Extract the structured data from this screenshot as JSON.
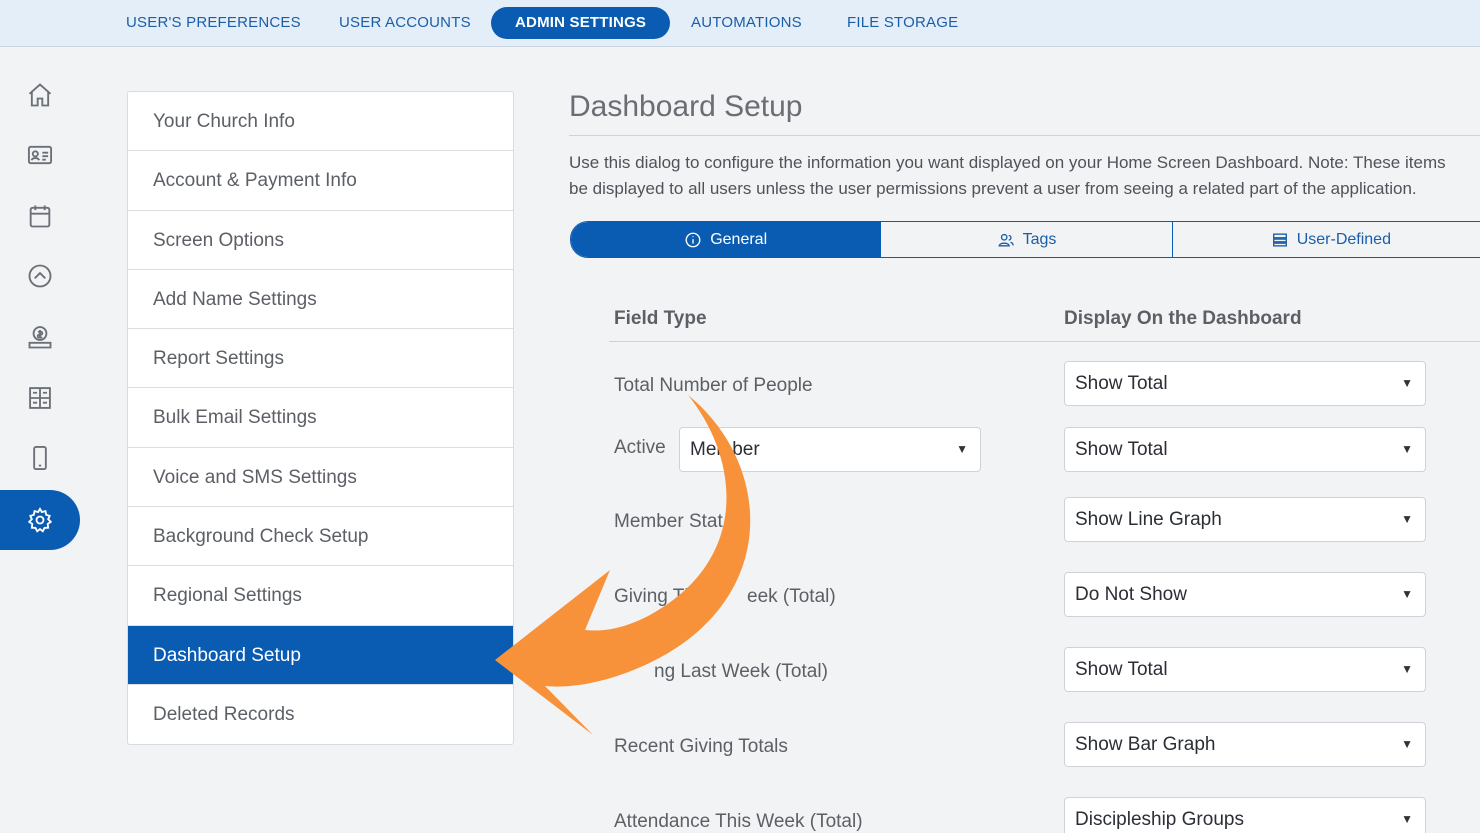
{
  "topnav": {
    "tabs": [
      {
        "label": "USER'S PREFERENCES"
      },
      {
        "label": "USER ACCOUNTS"
      },
      {
        "label": "ADMIN SETTINGS"
      },
      {
        "label": "AUTOMATIONS"
      },
      {
        "label": "FILE STORAGE"
      }
    ],
    "active": "ADMIN SETTINGS"
  },
  "rail": {
    "icons": [
      "home-icon",
      "contact-card-icon",
      "calendar-icon",
      "chevron-up-circle-icon",
      "donation-icon",
      "grid-icon",
      "mobile-icon",
      "gear-icon"
    ],
    "active": "gear-icon"
  },
  "menu": {
    "items": [
      {
        "label": "Your Church Info"
      },
      {
        "label": "Account & Payment Info"
      },
      {
        "label": "Screen Options"
      },
      {
        "label": "Add Name Settings"
      },
      {
        "label": "Report Settings"
      },
      {
        "label": "Bulk Email Settings"
      },
      {
        "label": "Voice and SMS Settings"
      },
      {
        "label": "Background Check Setup"
      },
      {
        "label": "Regional Settings"
      },
      {
        "label": "Dashboard Setup"
      },
      {
        "label": "Deleted Records"
      }
    ],
    "active": "Dashboard Setup"
  },
  "main": {
    "title": "Dashboard Setup",
    "description": "Use this dialog to configure the information you want displayed on your Home Screen Dashboard. Note: These items\nbe displayed to all users unless the user permissions prevent a user from seeing a related part of the application.",
    "tabs": [
      {
        "label": "General",
        "icon": "info-icon"
      },
      {
        "label": "Tags",
        "icon": "people-icon"
      },
      {
        "label": "User-Defined",
        "icon": "list-icon"
      }
    ],
    "table": {
      "headers": {
        "field_type": "Field Type",
        "display": "Display On the Dashboard"
      },
      "rows": [
        {
          "label": "Total Number of People",
          "display": "Show Total"
        },
        {
          "label": "Active",
          "filter": "Member",
          "display": "Show Total"
        },
        {
          "label": "Member Stat",
          "display": "Show Line Graph"
        },
        {
          "label": "Giving Th",
          "label_tail": "eek (Total)",
          "display": "Do Not Show"
        },
        {
          "label": "ng Last Week (Total)",
          "display": "Show Total"
        },
        {
          "label": "Recent Giving Totals",
          "display": "Show Bar Graph"
        },
        {
          "label": "Attendance This Week (Total)",
          "display": "Discipleship Groups"
        }
      ]
    }
  },
  "colors": {
    "primary": "#0a5cb2",
    "arrow": "#f7923a",
    "nav_bg": "#e3eef8"
  }
}
